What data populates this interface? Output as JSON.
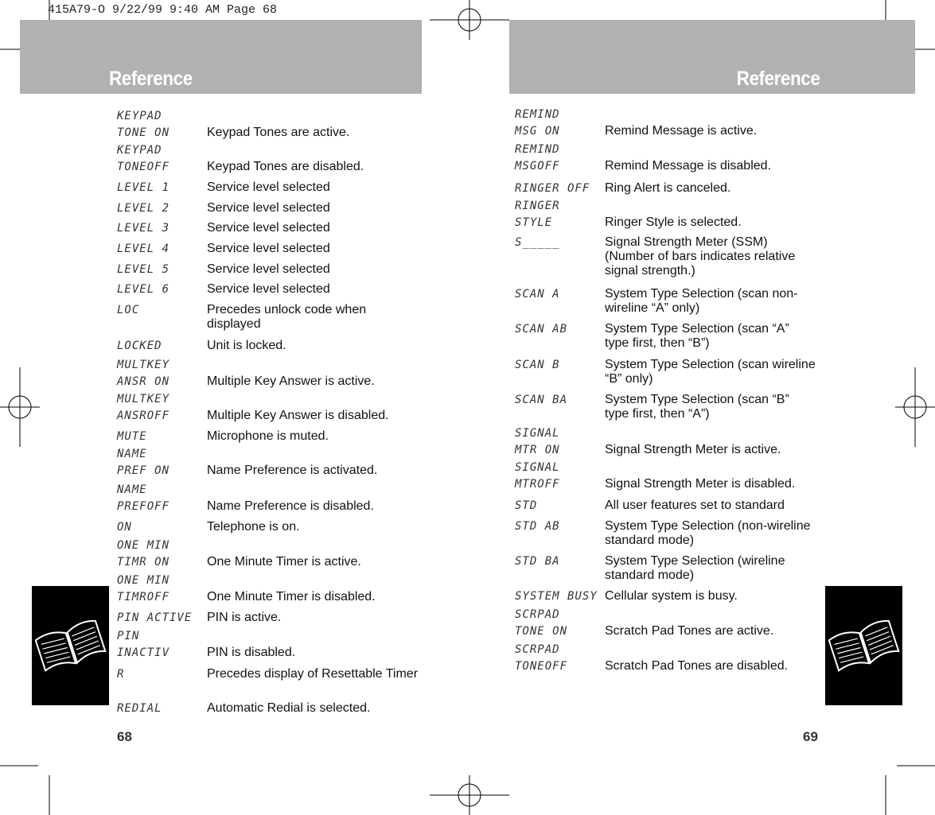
{
  "slug": "415A79-O  9/22/99 9:40 AM  Page 68",
  "left_page": {
    "header": "Reference",
    "page_number": "68",
    "entries": [
      {
        "code": [
          "KEYPAD",
          "TONE ON"
        ],
        "desc": "Keypad Tones are active."
      },
      {
        "code": [
          "KEYPAD",
          "TONEOFF"
        ],
        "desc": "Keypad Tones are disabled."
      },
      {
        "code": [
          "LEVEL 1"
        ],
        "desc": "Service level selected"
      },
      {
        "code": [
          "LEVEL 2"
        ],
        "desc": "Service level selected"
      },
      {
        "code": [
          "LEVEL 3"
        ],
        "desc": "Service level selected"
      },
      {
        "code": [
          "LEVEL 4"
        ],
        "desc": "Service level selected"
      },
      {
        "code": [
          "LEVEL 5"
        ],
        "desc": "Service level selected"
      },
      {
        "code": [
          "LEVEL 6"
        ],
        "desc": "Service level selected"
      },
      {
        "code": [
          "LOC"
        ],
        "desc": "Precedes unlock code when displayed"
      },
      {
        "code": [
          "LOCKED"
        ],
        "desc": "Unit is locked."
      },
      {
        "code": [
          "MULTKEY",
          "ANSR ON"
        ],
        "desc": "Multiple Key Answer is active."
      },
      {
        "code": [
          "MULTKEY",
          "ANSROFF"
        ],
        "desc": "Multiple Key Answer is disabled."
      },
      {
        "code": [
          "MUTE"
        ],
        "desc": "Microphone is muted."
      },
      {
        "code": [
          "NAME",
          "PREF ON"
        ],
        "desc": "Name Preference is activated."
      },
      {
        "code": [
          "NAME",
          "PREFOFF"
        ],
        "desc": "Name Preference is disabled."
      },
      {
        "code": [
          "ON"
        ],
        "desc": "Telephone is on."
      },
      {
        "code": [
          "ONE MIN",
          "TIMR ON"
        ],
        "desc": "One Minute Timer is active."
      },
      {
        "code": [
          "ONE MIN",
          "TIMROFF"
        ],
        "desc": "One Minute Timer is disabled."
      },
      {
        "code": [
          "PIN ACTIVE"
        ],
        "desc": "PIN is active."
      },
      {
        "code": [
          "PIN",
          "INACTIV"
        ],
        "desc": "PIN is disabled."
      },
      {
        "code": [
          "R"
        ],
        "desc": "Precedes display of Resettable Timer"
      },
      {
        "code": [
          "REDIAL"
        ],
        "desc": "Automatic Redial is selected."
      }
    ]
  },
  "right_page": {
    "header": "Reference",
    "page_number": "69",
    "entries": [
      {
        "code": [
          "REMIND",
          "MSG ON"
        ],
        "desc": "Remind Message is active."
      },
      {
        "code": [
          "REMIND",
          "MSGOFF"
        ],
        "desc": "Remind Message is disabled."
      },
      {
        "code": [
          "RINGER OFF"
        ],
        "desc": "Ring Alert is canceled."
      },
      {
        "code": [
          "RINGER",
          "STYLE"
        ],
        "desc": "Ringer Style is selected."
      },
      {
        "code": [
          "S_____"
        ],
        "desc": "Signal Strength Meter (SSM) (Number of bars indicates relative signal strength.)"
      },
      {
        "code": [
          "SCAN A"
        ],
        "desc": "System Type Selection (scan non-wireline “A” only)"
      },
      {
        "code": [
          "SCAN AB"
        ],
        "desc": "System Type Selection (scan “A” type first, then “B”)"
      },
      {
        "code": [
          "SCAN B"
        ],
        "desc": "System Type Selection (scan wireline “B” only)"
      },
      {
        "code": [
          "SCAN BA"
        ],
        "desc": "System Type Selection (scan “B” type first, then “A”)"
      },
      {
        "code": [
          "SIGNAL",
          "MTR ON"
        ],
        "desc": "Signal Strength Meter is active."
      },
      {
        "code": [
          "SIGNAL",
          "MTROFF"
        ],
        "desc": "Signal Strength Meter is disabled."
      },
      {
        "code": [
          "STD"
        ],
        "desc": "All user features set to standard"
      },
      {
        "code": [
          "STD AB"
        ],
        "desc": "System Type Selection (non-wireline standard mode)"
      },
      {
        "code": [
          "STD BA"
        ],
        "desc": "System Type Selection (wireline standard mode)"
      },
      {
        "code": [
          "SYSTEM BUSY"
        ],
        "desc": "Cellular system is busy."
      },
      {
        "code": [
          "SCRPAD",
          "TONE ON"
        ],
        "desc": "Scratch Pad Tones are active."
      },
      {
        "code": [
          "SCRPAD",
          "TONEOFF"
        ],
        "desc": "Scratch Pad Tones are disabled."
      }
    ]
  },
  "icons": {
    "tab_icon": "open-book-icon",
    "registration": "crosshair-registration-mark"
  },
  "colors": {
    "header_band": "#b1b1b1",
    "tab": "#000000"
  }
}
